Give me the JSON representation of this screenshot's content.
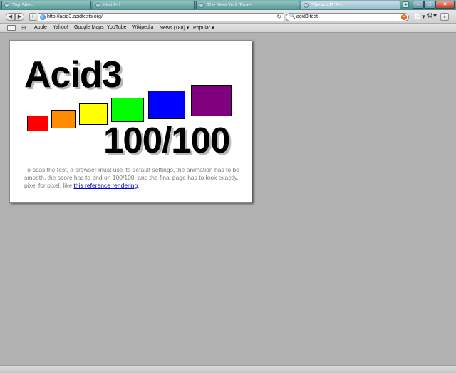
{
  "titlebar": {
    "tabs": [
      {
        "label": "Top Sites",
        "active": false
      },
      {
        "label": "Untitled",
        "active": false
      },
      {
        "label": "The New York Times",
        "active": false
      },
      {
        "label": "The Acid3 Test",
        "active": true
      }
    ],
    "new_tab_symbol": "+",
    "minimize_symbol": "–",
    "maximize_symbol": "□",
    "close_symbol": "✕"
  },
  "toolbar": {
    "back_symbol": "◀",
    "forward_symbol": "▶",
    "add_bookmark_symbol": "+",
    "address_url": "http://acid3.acidtests.org/",
    "reload_symbol": "↻",
    "search_query": "acid3 test",
    "search_icon_symbol": "🔍",
    "search_clear_symbol": "✕",
    "page_menu_symbol": "📄▾",
    "settings_menu_symbol": "⚙▾",
    "downloads_symbol": "⇣"
  },
  "bookmarks": {
    "book_symbol": "▢▢",
    "grid_symbol": "⊞",
    "items": [
      "Apple",
      "Yahoo!",
      "Google Maps",
      "YouTube",
      "Wikipedia",
      "News (188) ▾",
      "Popular ▾"
    ]
  },
  "acid3": {
    "title": "Acid3",
    "score": "100/100",
    "instructions_text": "To pass the test, a browser must use its default settings, the animation has to be smooth, the score has to end on 100/100, and the final page has to look exactly, pixel for pixel, like ",
    "reference_link": "this reference rendering",
    "end_punct": ".",
    "bucket_colors": [
      "#ff0000",
      "#ff8c00",
      "#ffff00",
      "#00ff00",
      "#0000ff",
      "#800080"
    ]
  }
}
